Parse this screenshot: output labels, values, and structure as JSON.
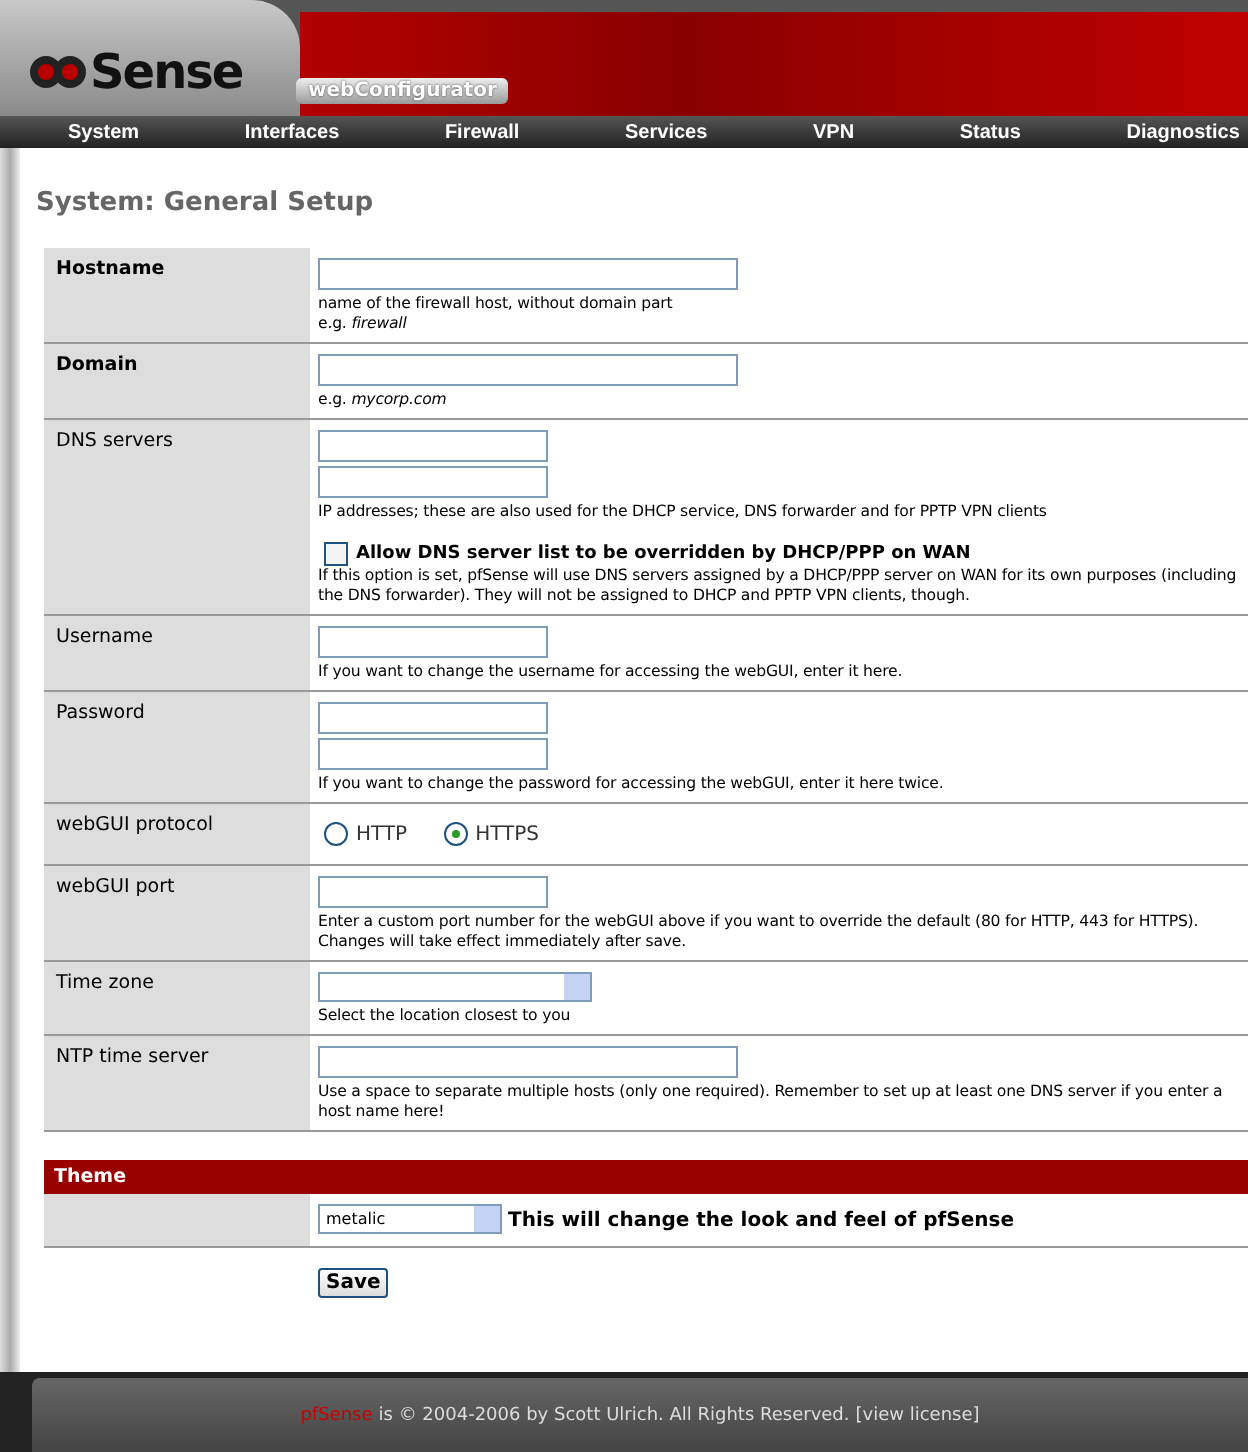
{
  "header": {
    "logo_text": "Sense",
    "badge": "webConfigurator"
  },
  "nav": [
    "System",
    "Interfaces",
    "Firewall",
    "Services",
    "VPN",
    "Status",
    "Diagnostics"
  ],
  "page_title": "System: General Setup",
  "rows": [
    {
      "label": "Hostname",
      "bold": true,
      "kind": "wide_text",
      "hints": [
        "name of the firewall host, without domain part",
        "e.g. *firewall*"
      ]
    },
    {
      "label": "Domain",
      "bold": true,
      "kind": "wide_text",
      "hints": [
        "e.g. *mycorp.com*"
      ]
    },
    {
      "label": "DNS servers",
      "bold": false,
      "kind": "short_text_pair",
      "hints": [
        "IP addresses; these are also used for the DHCP service, DNS forwarder and for PPTP VPN clients"
      ],
      "checkbox": {
        "label": "Allow DNS server list to be overridden by DHCP/PPP on WAN",
        "checked": false,
        "note": "If this option is set, pfSense will use DNS servers assigned by a DHCP/PPP server on WAN for its own purposes (including the DNS forwarder). They will not be assigned to DHCP and PPTP VPN clients, though."
      }
    },
    {
      "label": "Username",
      "bold": false,
      "kind": "short_text",
      "hints": [
        "If you want to change the username for accessing the webGUI, enter it here."
      ]
    },
    {
      "label": "Password",
      "bold": false,
      "kind": "short_text_pair",
      "hints": [
        "If you want to change the password for accessing the webGUI, enter it here twice."
      ]
    },
    {
      "label": "webGUI protocol",
      "bold": false,
      "kind": "radio",
      "options": [
        {
          "label": "HTTP",
          "selected": false
        },
        {
          "label": "HTTPS",
          "selected": true
        }
      ]
    },
    {
      "label": "webGUI port",
      "bold": false,
      "kind": "short_text",
      "hints": [
        "Enter a custom port number for the webGUI above if you want to override the default (80 for HTTP, 443 for HTTPS). Changes will take effect immediately after save."
      ]
    },
    {
      "label": "Time zone",
      "bold": false,
      "kind": "select",
      "hints": [
        "Select the location closest to you"
      ]
    },
    {
      "label": "NTP time server",
      "bold": false,
      "kind": "wide_text",
      "hints": [
        "Use a space to separate multiple hosts (only one required). Remember to set up at least one DNS server if you enter a host name here!"
      ]
    }
  ],
  "theme": {
    "title": "Theme",
    "value": "metalic",
    "description": "This will change the look and feel of pfSense"
  },
  "save_button": "Save",
  "footer": {
    "brand": "pfSense",
    "text": "is © 2004-2006 by Scott Ulrich. All Rights Reserved.",
    "link": "[view license]"
  }
}
